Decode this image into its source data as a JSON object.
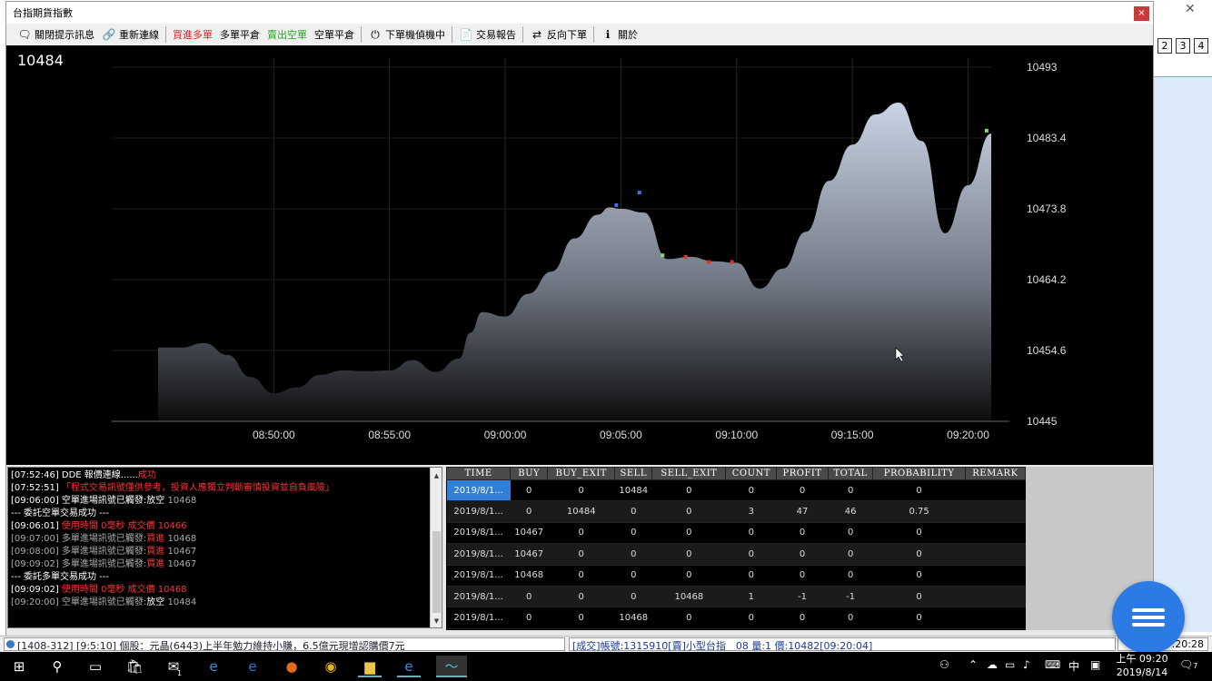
{
  "window": {
    "title": "台指期貨指數",
    "close_label": "×"
  },
  "background": {
    "close_label": "✕",
    "tabs": [
      "2",
      "3",
      "4"
    ]
  },
  "toolbar": [
    {
      "label": "關閉提示訊息",
      "icon": "message-icon",
      "glyph": "🗨",
      "color": "#000"
    },
    {
      "label": "重新連線",
      "icon": "link-icon",
      "glyph": "🔗",
      "color": "#000"
    },
    {
      "label": "買進多單",
      "icon": "",
      "glyph": "",
      "color": "#d22"
    },
    {
      "label": "多單平倉",
      "icon": "",
      "glyph": "",
      "color": "#000"
    },
    {
      "label": "賣出空單",
      "icon": "",
      "glyph": "",
      "color": "#2a2"
    },
    {
      "label": "空單平倉",
      "icon": "",
      "glyph": "",
      "color": "#000"
    },
    {
      "label": "下單機偵機中",
      "icon": "power-icon",
      "glyph": "⏻",
      "color": "#000"
    },
    {
      "label": "交易報告",
      "icon": "report-icon",
      "glyph": "📄",
      "color": "#000"
    },
    {
      "label": "反向下單",
      "icon": "reverse-order-icon",
      "glyph": "⇄",
      "color": "#000"
    },
    {
      "label": "關於",
      "icon": "info-icon",
      "glyph": "ℹ",
      "color": "#000"
    }
  ],
  "chart": {
    "current_price": "10484"
  },
  "chart_data": {
    "type": "area",
    "x_ticks": [
      "08:50:00",
      "08:55:00",
      "09:00:00",
      "09:05:00",
      "09:10:00",
      "09:15:00",
      "09:20:00"
    ],
    "y_ticks": [
      "10493",
      "10483.4",
      "10473.8",
      "10464.2",
      "10454.6",
      "10445"
    ],
    "ylim": [
      10445,
      10493
    ],
    "x_unit": "minutes since 08:45:00",
    "xlim": [
      -2,
      36
    ],
    "series": [
      {
        "values": [
          [
            0.0,
            10455.0
          ],
          [
            1.0,
            10455.0
          ],
          [
            2.0,
            10455.6
          ],
          [
            3.0,
            10454.0
          ],
          [
            4.0,
            10451.0
          ],
          [
            5.0,
            10448.8
          ],
          [
            6.0,
            10449.6
          ],
          [
            7.0,
            10451.3
          ],
          [
            8.0,
            10451.9
          ],
          [
            9.0,
            10451.8
          ],
          [
            10.0,
            10451.9
          ],
          [
            11.0,
            10453.3
          ],
          [
            12.0,
            10451.7
          ],
          [
            13.0,
            10453.5
          ],
          [
            13.5,
            10457.0
          ],
          [
            14.0,
            10459.8
          ],
          [
            15.0,
            10459.2
          ],
          [
            16.0,
            10462.3
          ],
          [
            17.0,
            10465.3
          ],
          [
            18.0,
            10469.8
          ],
          [
            19.0,
            10473.0
          ],
          [
            19.5,
            10474.0
          ],
          [
            20.0,
            10473.8
          ],
          [
            21.0,
            10473.3
          ],
          [
            22.0,
            10467.0
          ],
          [
            23.0,
            10467.3
          ],
          [
            24.0,
            10466.7
          ],
          [
            25.0,
            10466.5
          ],
          [
            26.0,
            10463.0
          ],
          [
            27.0,
            10465.7
          ],
          [
            28.0,
            10470.7
          ],
          [
            29.0,
            10477.6
          ],
          [
            30.0,
            10482.5
          ],
          [
            31.0,
            10486.6
          ],
          [
            32.0,
            10488.2
          ],
          [
            33.0,
            10483.0
          ],
          [
            34.0,
            10470.5
          ],
          [
            35.0,
            10477.0
          ],
          [
            36.0,
            10484.0
          ]
        ]
      }
    ],
    "markers": [
      {
        "x": 19.8,
        "y": 10474.3,
        "color": "#4a6ee0"
      },
      {
        "x": 20.8,
        "y": 10476.0,
        "color": "#4a6ee0"
      },
      {
        "x": 21.8,
        "y": 10467.5,
        "color": "#7fdc6a"
      },
      {
        "x": 22.8,
        "y": 10467.3,
        "color": "#e03030"
      },
      {
        "x": 23.8,
        "y": 10466.6,
        "color": "#e03030"
      },
      {
        "x": 24.8,
        "y": 10466.6,
        "color": "#e03030"
      },
      {
        "x": 35.8,
        "y": 10484.4,
        "color": "#7fdc6a"
      }
    ]
  },
  "log": [
    {
      "parts": [
        {
          "t": "[07:52:46] DDE 報價連線......",
          "c": "w"
        },
        {
          "t": "成功",
          "c": "r"
        }
      ]
    },
    {
      "parts": [
        {
          "t": "[07:52:51] ",
          "c": "w"
        },
        {
          "t": "「程式交易訊號僅供參考，投資人應獨立判斷審慎投資並自負風險」",
          "c": "r"
        }
      ]
    },
    {
      "parts": [
        {
          "t": "[09:06:00] 空單進場訊號已觸發:",
          "c": "w"
        },
        {
          "t": "放空",
          "c": "w"
        },
        {
          "t": " 10468",
          "c": "o"
        }
      ]
    },
    {
      "parts": [
        {
          "t": "--- 委託空單交易成功 ---",
          "c": "w"
        }
      ]
    },
    {
      "parts": [
        {
          "t": "[09:06:01] ",
          "c": "w"
        },
        {
          "t": "使用時間 0毫秒 成交價 10466",
          "c": "r"
        }
      ]
    },
    {
      "parts": [
        {
          "t": "[09:07:00] 多單進場訊號已觸發:",
          "c": "o"
        },
        {
          "t": "買進",
          "c": "r"
        },
        {
          "t": " 10468",
          "c": "o"
        }
      ]
    },
    {
      "parts": [
        {
          "t": "[09:08:00] 多單進場訊號已觸發:",
          "c": "o"
        },
        {
          "t": "買進",
          "c": "r"
        },
        {
          "t": " 10467",
          "c": "o"
        }
      ]
    },
    {
      "parts": [
        {
          "t": "[09:09:02] 多單進場訊號已觸發:",
          "c": "o"
        },
        {
          "t": "買進",
          "c": "r"
        },
        {
          "t": " 10467",
          "c": "o"
        }
      ]
    },
    {
      "parts": [
        {
          "t": "--- 委託多單交易成功 ---",
          "c": "w"
        }
      ]
    },
    {
      "parts": [
        {
          "t": "[09:09:02] ",
          "c": "w"
        },
        {
          "t": "使用時間 0毫秒 成交價 10468",
          "c": "r"
        }
      ]
    },
    {
      "parts": [
        {
          "t": "[09:20:00] 空單進場訊號已觸發:",
          "c": "o"
        },
        {
          "t": "放空",
          "c": "w"
        },
        {
          "t": " 10484",
          "c": "o"
        }
      ]
    }
  ],
  "table": {
    "columns": [
      "TIME",
      "BUY",
      "BUY_EXIT",
      "SELL",
      "SELL_EXIT",
      "COUNT",
      "PROFIT",
      "TOTAL",
      "PROBABILITY",
      "REMARK"
    ],
    "rows": [
      [
        "2019/8/1...",
        "0",
        "0",
        "10484",
        "0",
        "0",
        "0",
        "0",
        "0",
        ""
      ],
      [
        "2019/8/1...",
        "0",
        "10484",
        "0",
        "0",
        "3",
        "47",
        "46",
        "0.75",
        ""
      ],
      [
        "2019/8/1...",
        "10467",
        "0",
        "0",
        "0",
        "0",
        "0",
        "0",
        "0",
        ""
      ],
      [
        "2019/8/1...",
        "10467",
        "0",
        "0",
        "0",
        "0",
        "0",
        "0",
        "0",
        ""
      ],
      [
        "2019/8/1...",
        "10468",
        "0",
        "0",
        "0",
        "0",
        "0",
        "0",
        "0",
        ""
      ],
      [
        "2019/8/1...",
        "0",
        "0",
        "0",
        "10468",
        "1",
        "-1",
        "-1",
        "0",
        ""
      ],
      [
        "2019/8/1...",
        "0",
        "0",
        "10468",
        "0",
        "0",
        "0",
        "0",
        "0",
        ""
      ]
    ]
  },
  "status": {
    "news": "[1408-312] [9:5:10] 個股：元晶(6443)上半年勉力維持小賺，6.5億元現增認購價7元",
    "trade": "[成交]帳號:1315910[賣]小型台指　08 量:1 價:10482[09:20:04]",
    "time": "09:20:28"
  },
  "taskbar": {
    "clock_time": "上午 09:20",
    "clock_date": "2019/8/14",
    "ime": "中",
    "notification_count": "7",
    "mail_badge": "1"
  }
}
